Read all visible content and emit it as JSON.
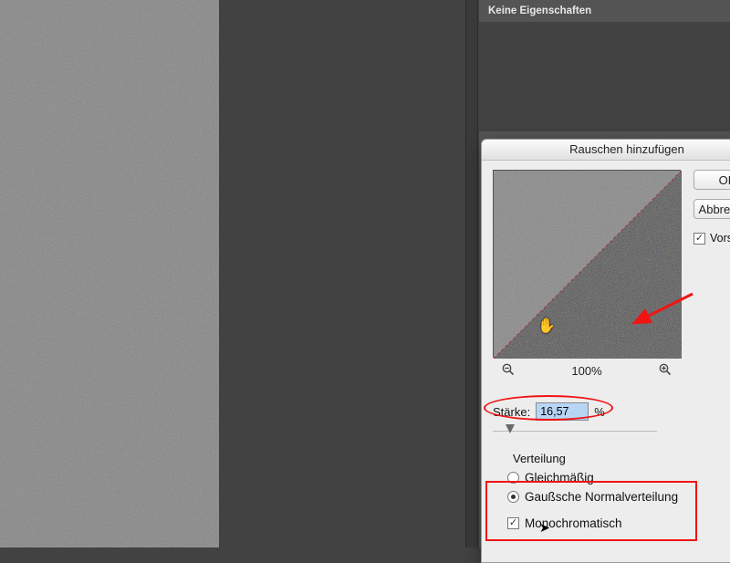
{
  "panel": {
    "header": "Keine Eigenschaften"
  },
  "dialog": {
    "title": "Rauschen hinzufügen",
    "buttons": {
      "ok": "OK",
      "cancel": "Abbrechen"
    },
    "preview_checkbox": {
      "label": "Vorschau",
      "checked": true
    },
    "zoom": {
      "out_icon": "zoom-out-icon",
      "level": "100%",
      "in_icon": "zoom-in-icon"
    },
    "amount": {
      "label": "Stärke:",
      "value": "16,57",
      "unit": "%",
      "slider_pct": 10
    },
    "distribution": {
      "group_label": "Verteilung",
      "options": [
        {
          "label": "Gleichmäßig",
          "selected": false
        },
        {
          "label": "Gaußsche Normalverteilung",
          "selected": true
        }
      ]
    },
    "monochrome": {
      "label": "Monochromatisch",
      "checked": true
    }
  },
  "annotations": {
    "arrow_target": "preview-split-colored-region"
  }
}
